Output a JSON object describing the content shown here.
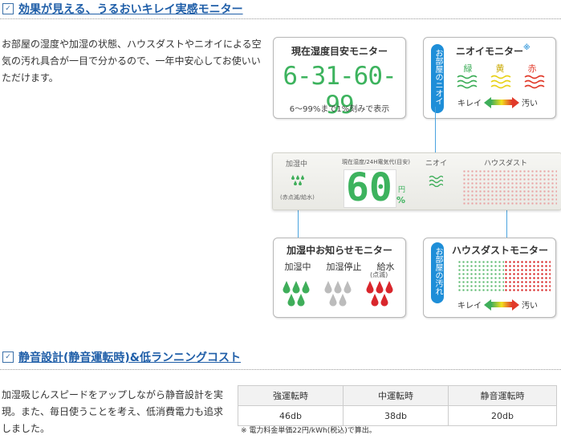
{
  "section1": {
    "title": "効果が見える、うるおいキレイ実感モニター",
    "description": "お部屋の湿度や加湿の状態、ハウスダストやニオイによる空気の汚れ具合が一目で分かるので、一年中安心してお使いいただけます。"
  },
  "humidity_card": {
    "title": "現在湿度目安モニター",
    "digits": "6-31-60-99",
    "note": "6〜99%まで1%刻みで表示"
  },
  "odor_card": {
    "title": "ニオイモニター",
    "mark": "※",
    "pill": "お部屋のニオイ",
    "levels": [
      "緑",
      "黄",
      "赤"
    ],
    "level_colors": [
      "#3fae5a",
      "#e8d21a",
      "#e13a2a"
    ],
    "clean": "キレイ",
    "dirty": "汚い"
  },
  "panel": {
    "humidify_label": "加湿中",
    "humidify_sub": "(赤点滅/給水)",
    "display_label": "現在湿度/24H電気代",
    "display_unit_tag": "(目安)",
    "value": "60",
    "unit_yen": "円",
    "unit_pct": "%",
    "odor_label": "ニオイ",
    "dust_label": "ハウスダスト"
  },
  "humidify_card": {
    "title": "加湿中お知らせモニター",
    "states": [
      "加湿中",
      "加湿停止",
      "給水"
    ],
    "state_sub": "(点滅)",
    "drop_colors": [
      "#3fae5a",
      "#bcbcbc",
      "#d9262c"
    ]
  },
  "dust_card": {
    "title": "ハウスダストモニター",
    "pill": "お部屋の汚れ",
    "clean": "キレイ",
    "dirty": "汚い"
  },
  "section2": {
    "title": "静音設計(静音運転時)&低ランニングコスト",
    "description": "加湿吸じんスピードをアップしながら静音設計を実現。また、毎日使うことを考え、低消費電力も追求しました。"
  },
  "spec_table": {
    "headers": [
      "強運転時",
      "中運転時",
      "静音運転時"
    ],
    "values": [
      "46db",
      "38db",
      "20db"
    ],
    "note": "※ 電力料金単価22円/kWh(税込)で算出。"
  },
  "icons": [
    "check-icon",
    "wave-icon",
    "drop-icon",
    "arrow-icon",
    "dot-pattern-icon"
  ]
}
